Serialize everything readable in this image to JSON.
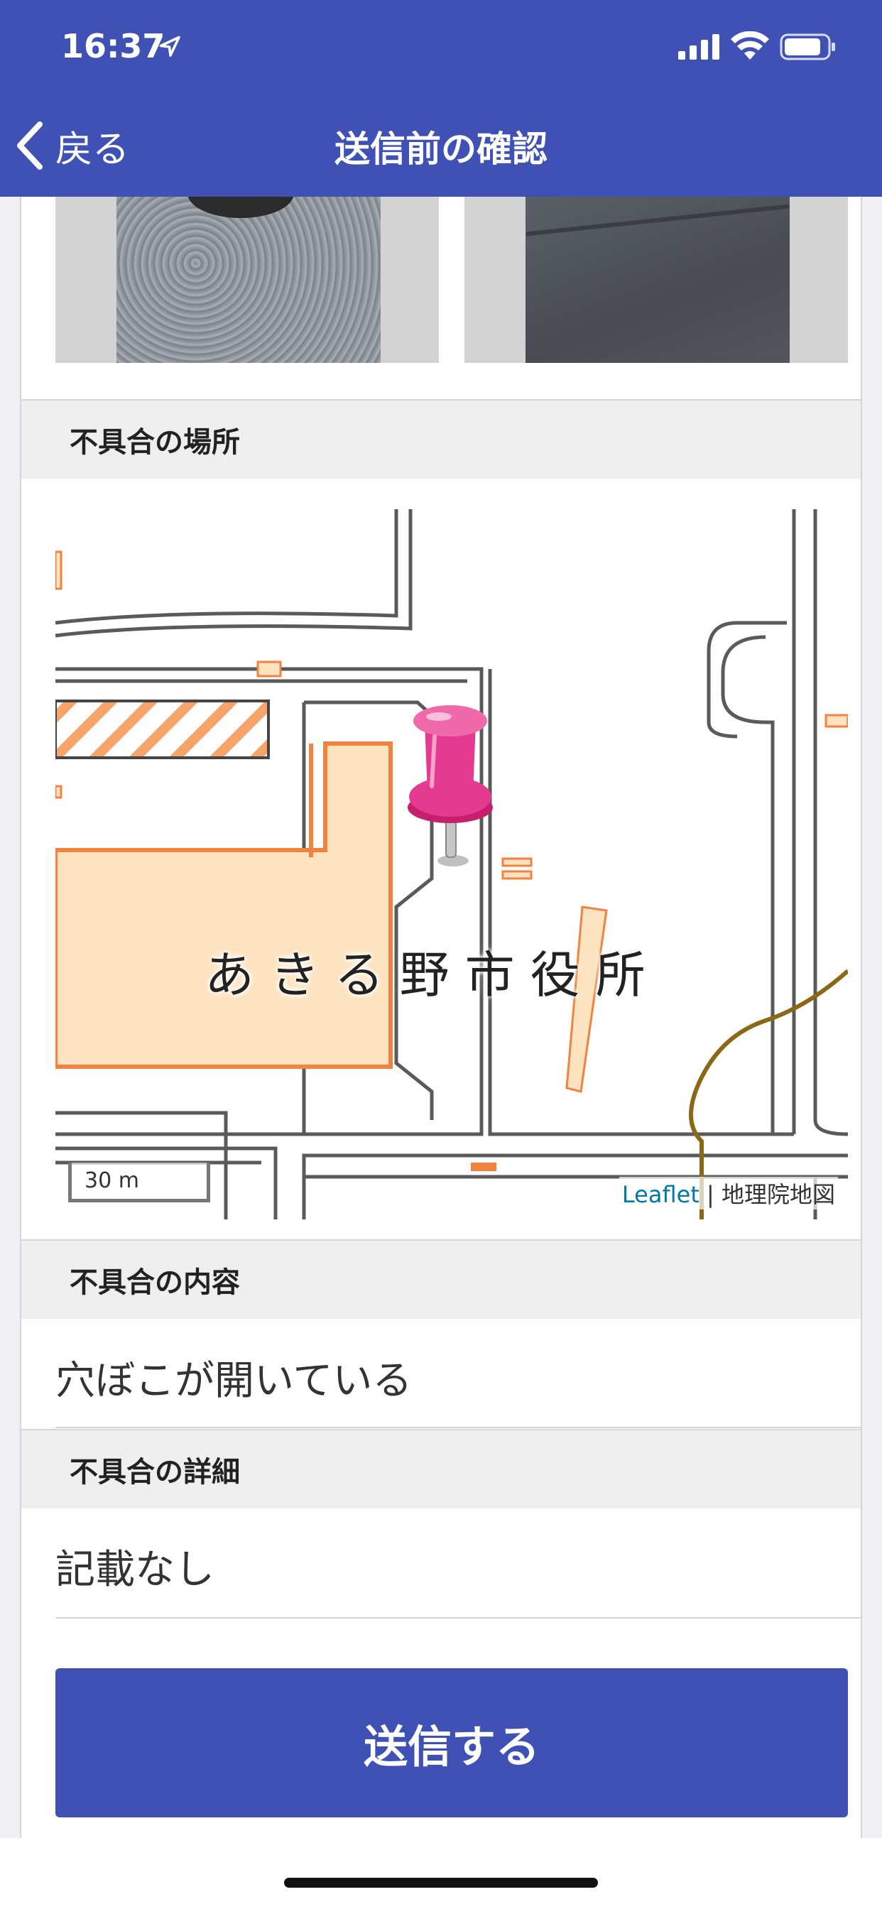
{
  "status_bar": {
    "time": "16:37",
    "icons": [
      "location-arrow-icon",
      "cellular-signal-icon",
      "wifi-icon",
      "battery-icon"
    ]
  },
  "nav": {
    "back_label": "戻る",
    "title": "送信前の確認"
  },
  "photos": {
    "count": 2
  },
  "sections": {
    "location_header": "不具合の場所",
    "content_header": "不具合の内容",
    "content_value": "穴ぼこが開いている",
    "detail_header": "不具合の詳細",
    "detail_value": "記載なし"
  },
  "map": {
    "place_label": "あきる野市役所",
    "scale_label": "30 m",
    "attribution_link": "Leaflet",
    "attribution_separator": " | ",
    "attribution_source": "地理院地図",
    "marker_icon": "pushpin-icon"
  },
  "actions": {
    "submit_label": "送信する"
  },
  "colors": {
    "primary": "#3f51b5",
    "building_fill": "#fde3c0",
    "building_stroke": "#f4823f",
    "road_stroke": "#5a5a5a",
    "pin": "#e43a8f",
    "link": "#0078a8"
  }
}
